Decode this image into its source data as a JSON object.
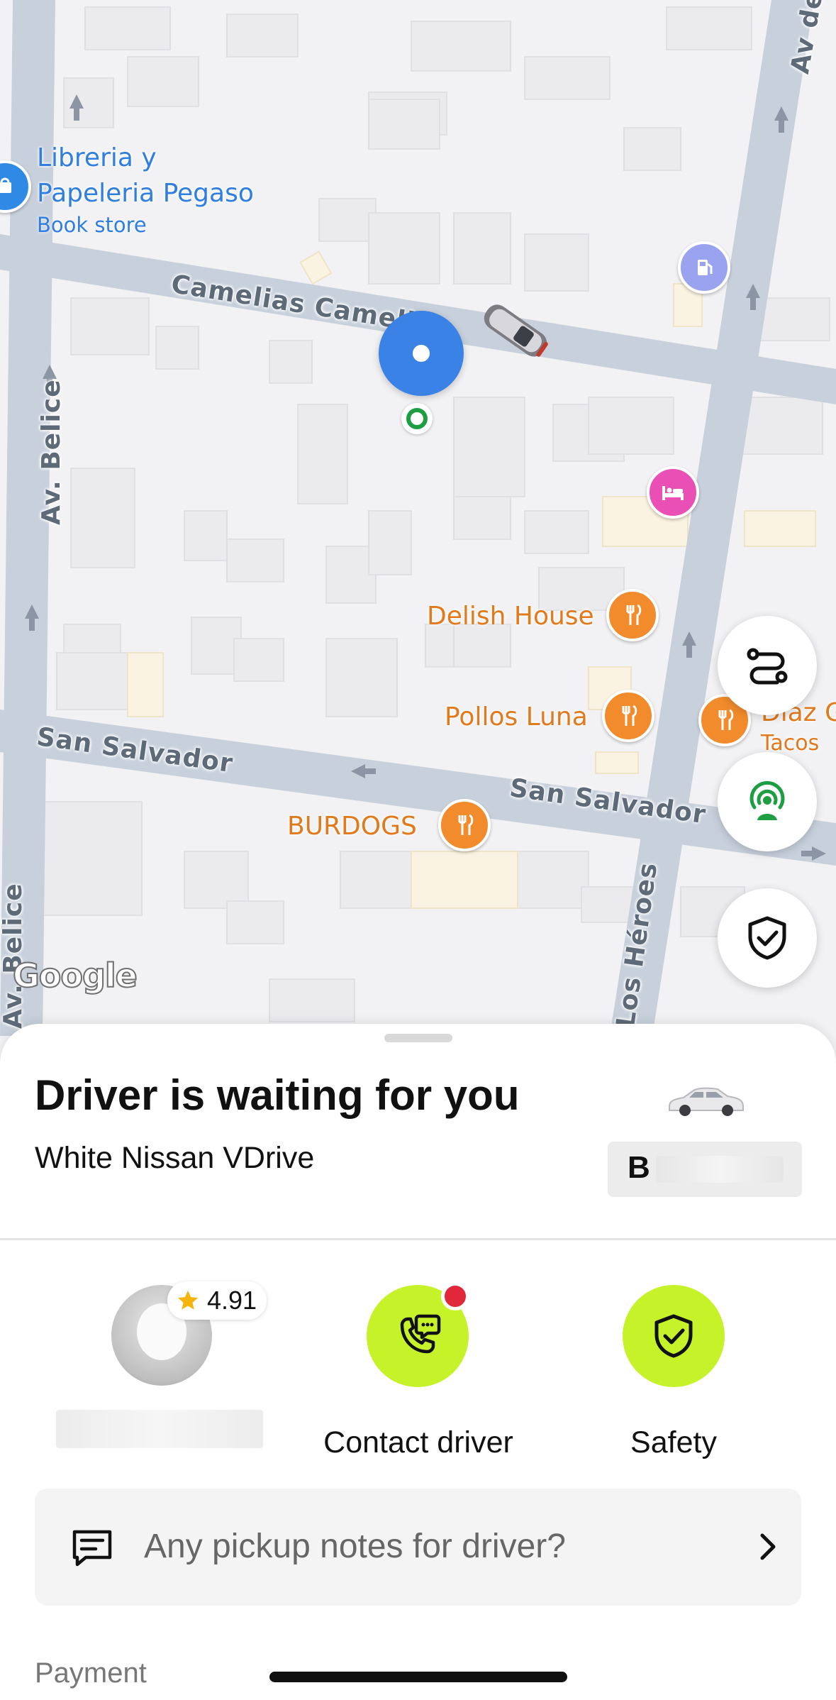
{
  "map": {
    "streets": {
      "camelias": "Camelias Camelias",
      "belice_left": "Av. Belice",
      "belice_bottom": "Av. Belice",
      "san_salvador_left": "San Salvador",
      "san_salvador_right": "San Salvador",
      "heroes": "Los Héroes",
      "av_top_right": "Av de"
    },
    "pois": {
      "bookstore_name_line1": "Libreria y",
      "bookstore_name_line2": "Papeleria Pegaso",
      "bookstore_type": "Book store",
      "delish": "Delish House",
      "pollos": "Pollos Luna",
      "burdogs": "BURDOGS",
      "diaz": "Diaz G",
      "diaz_sub": "Tacos"
    },
    "attribution": "Google"
  },
  "sheet": {
    "title": "Driver is waiting for you",
    "vehicle": "White Nissan VDrive",
    "plate_visible": "B",
    "driver_rating": "4.91",
    "actions": {
      "contact_label": "Contact driver",
      "safety_label": "Safety"
    },
    "notes_placeholder": "Any pickup notes for driver?",
    "payment_label": "Payment"
  },
  "colors": {
    "accent_green": "#c6f22a",
    "pickup_blue": "#3b82e6",
    "pin_orange": "#f28b2b",
    "badge_red": "#e0283a"
  }
}
